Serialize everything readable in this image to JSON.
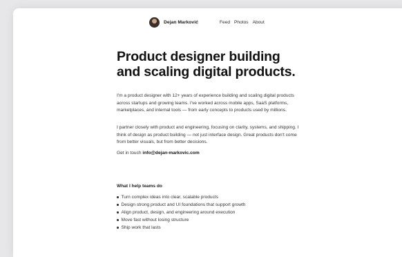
{
  "nav": {
    "name": "Dejan Marković",
    "links": [
      "Feed",
      "Photos",
      "About"
    ]
  },
  "hero": {
    "title": "Product designer building and scaling digital products.",
    "paragraph1": "I'm a product designer with 12+ years of experience building and scaling digital products across startups and growing teams. I've worked across mobile apps, SaaS platforms, marketplaces, and internal tools — from early concepts to products used by millions.",
    "paragraph2": "I partner closely with product and engineering, focusing on clarity, systems, and shipping. I think of design as product building — not just interface design. Great products don't come from better visuals, but from better decisions.",
    "contact_label": "Get in touch",
    "contact_email": "info@dejan-markovic.com"
  },
  "help": {
    "title": "What I help teams do",
    "items": [
      "Turn complex ideas into clear, scalable products",
      "Design strong product and UI foundations that support growth",
      "Align product, design, and engineering around execution",
      "Move fast without losing structure",
      "Ship work that lasts"
    ]
  }
}
